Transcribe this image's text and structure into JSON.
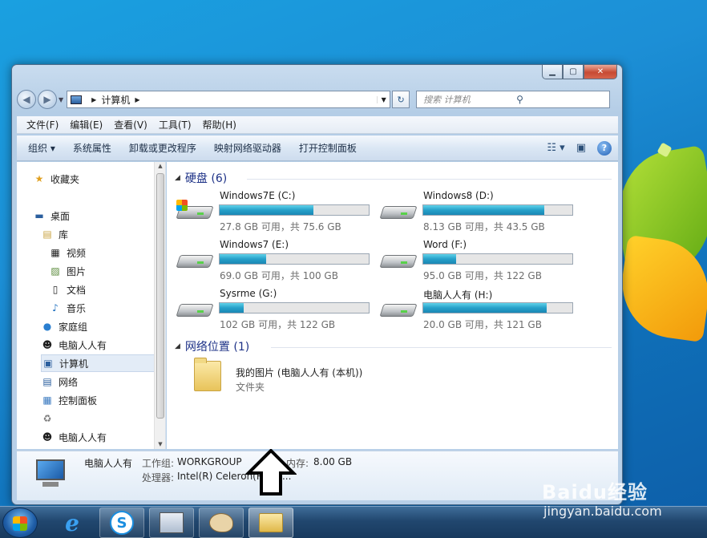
{
  "window": {
    "address": {
      "crumb": "计算机"
    },
    "search": {
      "placeholder": "搜索 计算机"
    },
    "menu": [
      "文件(F)",
      "编辑(E)",
      "查看(V)",
      "工具(T)",
      "帮助(H)"
    ],
    "commands": [
      "组织 ▾",
      "系统属性",
      "卸载或更改程序",
      "映射网络驱动器",
      "打开控制面板"
    ],
    "nav": {
      "favorites": "收藏夹",
      "desktop": "桌面",
      "libraries": "库",
      "videos": "视频",
      "pictures": "图片",
      "documents": "文档",
      "music": "音乐",
      "homegroup": "家庭组",
      "user": "电脑人人有",
      "computer": "计算机",
      "network": "网络",
      "control_panel": "控制面板",
      "user2": "电脑人人有"
    },
    "groups": {
      "hard_disks": "硬盘 (6)",
      "network_locations": "网络位置 (1)"
    },
    "drives": [
      {
        "name": "Windows7E (C:)",
        "info": "27.8 GB 可用，共 75.6 GB",
        "used_fraction": 0.63,
        "system": true
      },
      {
        "name": "Windows8 (D:)",
        "info": "8.13 GB 可用，共 43.5 GB",
        "used_fraction": 0.81,
        "system": false
      },
      {
        "name": "Windows7 (E:)",
        "info": "69.0 GB 可用，共 100 GB",
        "used_fraction": 0.31,
        "system": false
      },
      {
        "name": "Word (F:)",
        "info": "95.0 GB 可用，共 122 GB",
        "used_fraction": 0.22,
        "system": false
      },
      {
        "name": "Sysrme (G:)",
        "info": "102 GB 可用，共 122 GB",
        "used_fraction": 0.16,
        "system": false
      },
      {
        "name": "电脑人人有 (H:)",
        "info": "20.0 GB 可用，共 121 GB",
        "used_fraction": 0.83,
        "system": false
      }
    ],
    "network_folder": {
      "name": "我的图片 (电脑人人有 (本机))",
      "type": "文件夹"
    },
    "details": {
      "computer_name": "电脑人人有",
      "workgroup_label": "工作组:",
      "workgroup": "WORKGROUP",
      "memory_label": "内存:",
      "memory": "8.00 GB",
      "processor_label": "处理器:",
      "processor": "Intel(R) Celeron(R) 29..."
    }
  },
  "colors": {
    "accent": "#1e3287",
    "bar_fill": "#26a0c9"
  },
  "watermark": {
    "brand": "Baidu经验",
    "url": "jingyan.baidu.com"
  }
}
